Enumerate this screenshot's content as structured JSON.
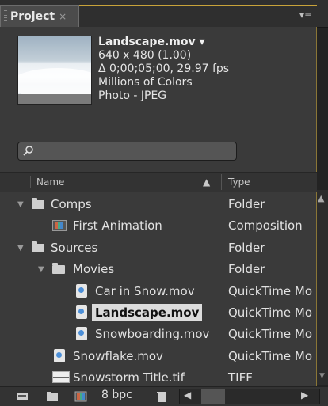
{
  "panel": {
    "tab_label": "Project",
    "close_glyph": "×",
    "menu_glyph": "▾≡"
  },
  "preview": {
    "file_name": "Landscape.mov ▾",
    "dimensions": "640 x 480 (1.00)",
    "duration": "Δ 0;00;05;00, 29.97 fps",
    "colors": "Millions of Colors",
    "codec": "Photo - JPEG"
  },
  "search": {
    "value": ""
  },
  "columns": {
    "name": "Name",
    "type": "Type"
  },
  "items": [
    {
      "name": "Comps",
      "type": "Folder",
      "kind": "folder",
      "expanded": true
    },
    {
      "name": "First Animation",
      "type": "Composition",
      "kind": "composition"
    },
    {
      "name": "Sources",
      "type": "Folder",
      "kind": "folder",
      "expanded": true
    },
    {
      "name": "Movies",
      "type": "Folder",
      "kind": "folder",
      "expanded": true
    },
    {
      "name": "Car in Snow.mov",
      "type": "QuickTime Mo",
      "kind": "quicktime"
    },
    {
      "name": "Landscape.mov",
      "type": "QuickTime Mo",
      "kind": "quicktime",
      "selected": true
    },
    {
      "name": "Snowboarding.mov",
      "type": "QuickTime Mo",
      "kind": "quicktime"
    },
    {
      "name": "Snowflake.mov",
      "type": "QuickTime Mo",
      "kind": "quicktime"
    },
    {
      "name": "Snowstorm Title.tif",
      "type": "TIFF",
      "kind": "tiff"
    }
  ],
  "bottom": {
    "bit_depth": "8 bpc"
  },
  "colors": {
    "panel_bg": "#3a3a3a",
    "accent_border": "#c9a33a",
    "selection_bg": "#dcdcdc"
  },
  "icons": [
    "search-icon",
    "folder-icon",
    "composition-icon",
    "quicktime-icon",
    "tiff-icon",
    "interpret-footage-icon",
    "new-folder-icon",
    "new-composition-icon",
    "trash-icon"
  ]
}
